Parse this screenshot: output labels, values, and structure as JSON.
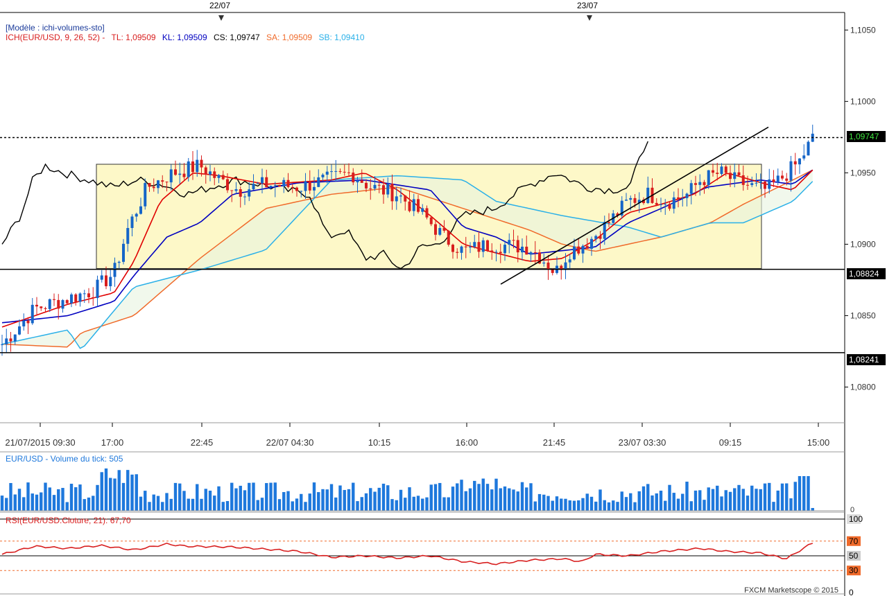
{
  "chart_data": [
    {
      "type": "candlestick",
      "model_label": "[Modèle : ichi-volumes-sto]",
      "indicator": {
        "name": "ICH(EUR/USD, 9, 26, 52) -",
        "tl_label": "TL: 1,09509",
        "kl_label": "KL: 1,09509",
        "cs_label": "CS: 1,09747",
        "sa_label": "SA: 1,09509",
        "sb_label": "SB: 1,09410"
      },
      "top_dates": [
        "22/07",
        "23/07"
      ],
      "y_ticks": [
        "1,1050",
        "1,1000",
        "1,0950",
        "1,0900",
        "1,0850",
        "1,0800"
      ],
      "ylim": [
        1.0775,
        1.1055
      ],
      "x_ticks": [
        "21/07/2015 09:30",
        "17:00",
        "22:45",
        "22/07 04:30",
        "10:15",
        "16:00",
        "21:45",
        "23/07 03:30",
        "09:15",
        "15:00"
      ],
      "price_labels": {
        "current": "1,09747",
        "level_high": "1,08824",
        "level_low": "1,08241"
      },
      "levels": {
        "current": 1.09747,
        "support1": 1.08824,
        "support2": 1.08241
      },
      "box": {
        "top": 1.0956,
        "bottom": 1.0883
      },
      "colors": {
        "up": "#1565c8",
        "down": "#d81e1e",
        "tenkan": "#e00000",
        "kijun": "#0000c0",
        "chikou": "#000000",
        "senkou_a": "#f06a2a",
        "senkou_b": "#2ab0e8",
        "box": "#fdf8c8"
      }
    },
    {
      "type": "bar",
      "title": "EUR/USD - Volume du tick: 505",
      "ylabel": "0",
      "color": "#1e78dc"
    },
    {
      "type": "line",
      "title": "RSI(EUR/USD.Cloture, 21): 67,70",
      "y_ticks": [
        "100",
        "70",
        "50",
        "30",
        "0"
      ],
      "ylim": [
        0,
        100
      ],
      "color": "#d81e1e"
    }
  ],
  "footer": {
    "credit": "FXCM Marketscope © 2015"
  }
}
